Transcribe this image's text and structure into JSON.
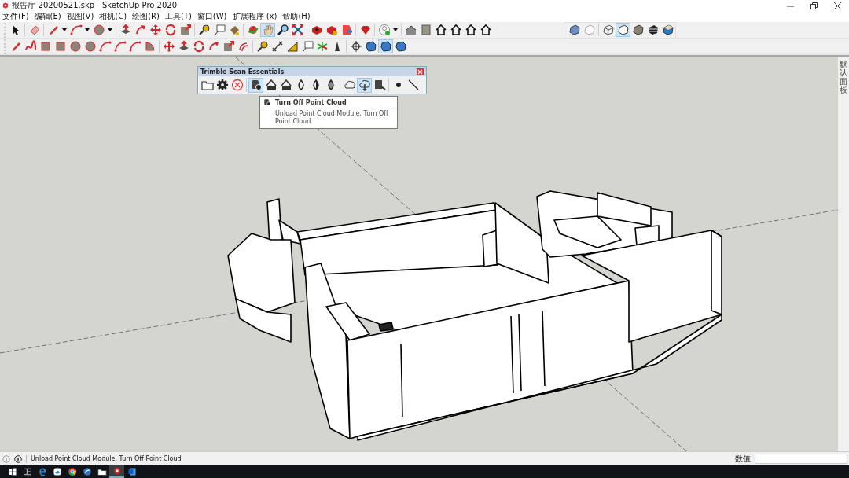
{
  "window": {
    "title": "报告厅-20200521.skp - SketchUp Pro 2020"
  },
  "menu": [
    {
      "label": "文件(F)"
    },
    {
      "label": "编辑(E)"
    },
    {
      "label": "视图(V)"
    },
    {
      "label": "相机(C)"
    },
    {
      "label": "绘图(R)"
    },
    {
      "label": "工具(T)"
    },
    {
      "label": "窗口(W)"
    },
    {
      "label": "扩展程序 (x)"
    },
    {
      "label": "帮助(H)"
    }
  ],
  "toolbar_rows": [
    {
      "toolbars": [
        [
          {
            "kind": "select",
            "selected": false
          },
          {
            "kind": "sep"
          },
          {
            "kind": "eraser",
            "selected": false
          },
          {
            "kind": "sep"
          },
          {
            "kind": "pencil",
            "selected": false
          },
          {
            "kind": "dropdown",
            "selected": false
          },
          {
            "kind": "arc",
            "selected": false
          },
          {
            "kind": "dropdown",
            "selected": false
          },
          {
            "kind": "circle",
            "selected": false
          },
          {
            "kind": "dropdown",
            "selected": false
          },
          {
            "kind": "sep"
          },
          {
            "kind": "pushpull",
            "selected": false
          },
          {
            "kind": "followme",
            "selected": false
          },
          {
            "kind": "move",
            "selected": false
          },
          {
            "kind": "rotate",
            "selected": false
          },
          {
            "kind": "scale",
            "selected": false
          },
          {
            "kind": "sep"
          },
          {
            "kind": "tape",
            "selected": false
          },
          {
            "kind": "label",
            "selected": false
          },
          {
            "kind": "paint",
            "selected": false
          },
          {
            "kind": "sep"
          },
          {
            "kind": "orbit",
            "selected": false
          },
          {
            "kind": "pan",
            "selected": true
          },
          {
            "kind": "zoom",
            "selected": false
          },
          {
            "kind": "extents",
            "selected": false
          },
          {
            "kind": "sep"
          },
          {
            "kind": "warehouse",
            "selected": false
          },
          {
            "kind": "extension",
            "selected": false
          },
          {
            "kind": "layout",
            "selected": false
          },
          {
            "kind": "sep"
          },
          {
            "kind": "ruby",
            "selected": false
          },
          {
            "kind": "sep"
          },
          {
            "kind": "account",
            "selected": false
          },
          {
            "kind": "dropdown",
            "selected": false
          },
          {
            "kind": "sep"
          },
          {
            "kind": "iso",
            "selected": false
          },
          {
            "kind": "wall",
            "selected": false
          },
          {
            "kind": "house",
            "selected": false
          },
          {
            "kind": "house",
            "selected": false
          },
          {
            "kind": "house",
            "selected": false
          },
          {
            "kind": "house",
            "selected": false
          }
        ],
        [
          {
            "kind": "xray",
            "selected": false
          },
          {
            "kind": "backedges",
            "selected": false
          },
          {
            "kind": "sep"
          },
          {
            "kind": "wireframe",
            "selected": false
          },
          {
            "kind": "hiddenline",
            "selected": true
          },
          {
            "kind": "shaded",
            "selected": false
          },
          {
            "kind": "textured",
            "selected": false
          },
          {
            "kind": "monochrome",
            "selected": false
          }
        ]
      ]
    },
    {
      "toolbars": [
        [
          {
            "kind": "pencil",
            "selected": false
          },
          {
            "kind": "freehand",
            "selected": false
          },
          {
            "kind": "rect",
            "selected": false
          },
          {
            "kind": "rect",
            "selected": false
          },
          {
            "kind": "circle",
            "selected": false
          },
          {
            "kind": "circle",
            "selected": false
          },
          {
            "kind": "arc",
            "selected": false
          },
          {
            "kind": "arc",
            "selected": false
          },
          {
            "kind": "arc",
            "selected": false
          },
          {
            "kind": "pie",
            "selected": false
          },
          {
            "kind": "sep"
          },
          {
            "kind": "move",
            "selected": false
          },
          {
            "kind": "pushpull",
            "selected": false
          },
          {
            "kind": "rotate",
            "selected": false
          },
          {
            "kind": "followme",
            "selected": false
          },
          {
            "kind": "scale",
            "selected": false
          },
          {
            "kind": "offset",
            "selected": false
          },
          {
            "kind": "sep"
          },
          {
            "kind": "tape",
            "selected": false
          },
          {
            "kind": "dimension",
            "selected": false
          },
          {
            "kind": "protractor",
            "selected": false
          },
          {
            "kind": "label",
            "selected": false
          },
          {
            "kind": "axes",
            "selected": false
          },
          {
            "kind": "text3d",
            "selected": false
          },
          {
            "kind": "sep"
          },
          {
            "kind": "crosshair",
            "selected": false
          },
          {
            "kind": "section",
            "selected": false
          },
          {
            "kind": "section",
            "selected": true
          },
          {
            "kind": "section",
            "selected": false
          }
        ]
      ]
    }
  ],
  "scan_toolbar": {
    "title": "Trimble Scan Essentials",
    "items": [
      {
        "kind": "folder",
        "selected": false
      },
      {
        "kind": "gear",
        "selected": false
      },
      {
        "kind": "cancel",
        "selected": false
      },
      {
        "kind": "sep"
      },
      {
        "kind": "cloudoff",
        "selected": true
      },
      {
        "kind": "fifty",
        "selected": false
      },
      {
        "kind": "seventyfive",
        "selected": false
      },
      {
        "kind": "ring",
        "selected": false
      },
      {
        "kind": "half",
        "selected": false
      },
      {
        "kind": "hatched",
        "selected": false
      },
      {
        "kind": "sep"
      },
      {
        "kind": "cloudx",
        "selected": false
      },
      {
        "kind": "clouddown",
        "selected": true
      },
      {
        "kind": "export",
        "selected": false
      },
      {
        "kind": "sep"
      },
      {
        "kind": "dot",
        "selected": false
      },
      {
        "kind": "line",
        "selected": false
      }
    ]
  },
  "tooltip": {
    "title": "Turn Off Point Cloud",
    "description": "Unload Point Cloud Module, Turn Off Point Cloud"
  },
  "tray": {
    "label": "默认面板"
  },
  "status_bar": {
    "message": "Unload Point Cloud Module, Turn Off Point Cloud",
    "measurement_label": "数值"
  },
  "taskbar": [
    {
      "kind": "start",
      "active": false
    },
    {
      "kind": "taskview",
      "active": false
    },
    {
      "kind": "edge",
      "active": false
    },
    {
      "kind": "cloudapp",
      "active": false
    },
    {
      "kind": "chrome",
      "active": false
    },
    {
      "kind": "bluecircle",
      "active": false
    },
    {
      "kind": "folder",
      "active": false
    },
    {
      "kind": "sketchup",
      "active": true
    },
    {
      "kind": "word",
      "active": false
    }
  ]
}
